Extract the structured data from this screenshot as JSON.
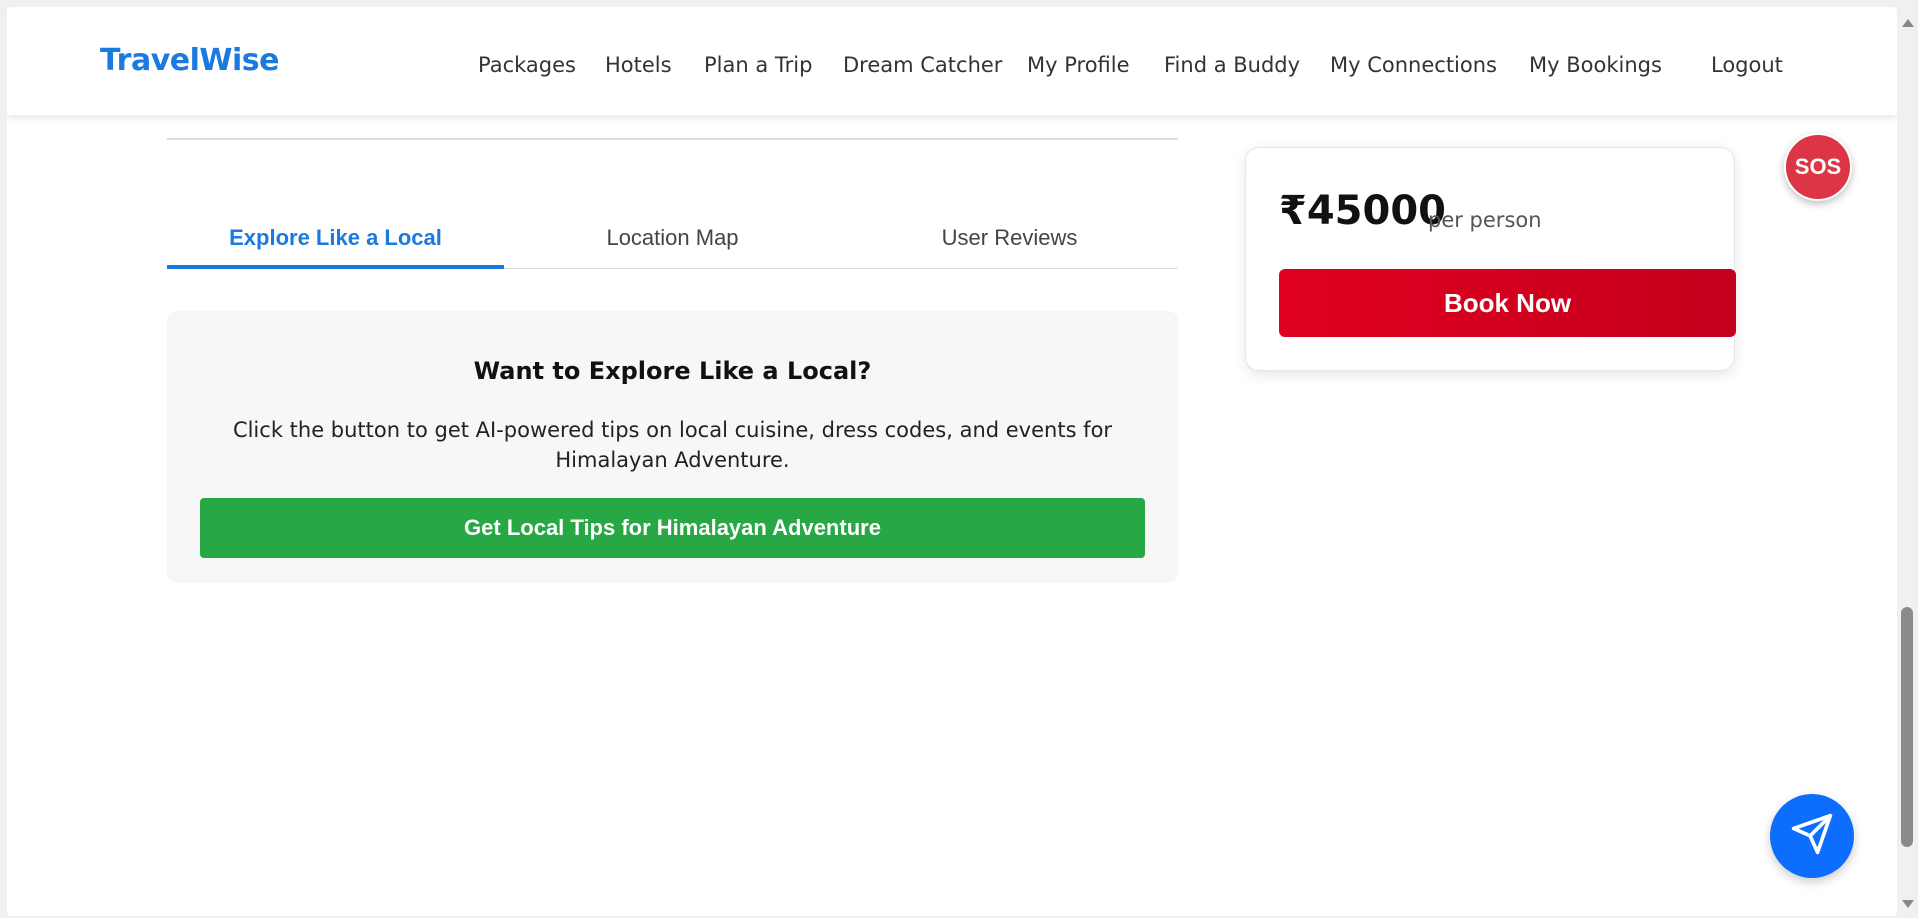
{
  "header": {
    "brand": "TravelWise",
    "nav": [
      "Packages",
      "Hotels",
      "Plan a Trip",
      "Dream Catcher",
      "My Profile",
      "Find a Buddy",
      "My Connections",
      "My Bookings",
      "Logout"
    ]
  },
  "tabs": [
    {
      "label": "Explore Like a Local",
      "active": true
    },
    {
      "label": "Location Map",
      "active": false
    },
    {
      "label": "User Reviews",
      "active": false
    }
  ],
  "local": {
    "title": "Want to Explore Like a Local?",
    "description": "Click the button to get AI-powered tips on local cuisine, dress codes, and events for Himalayan Adventure.",
    "button_label": "Get Local Tips for Himalayan Adventure"
  },
  "booking": {
    "price": "₹45000",
    "per_label": "per person",
    "button_label": "Book Now"
  },
  "sos_label": "SOS",
  "icons": {
    "send": "send-icon"
  },
  "colors": {
    "brand": "#1a7ae0",
    "success": "#28a745",
    "danger": "#dc3545",
    "book": "#e0001f"
  }
}
